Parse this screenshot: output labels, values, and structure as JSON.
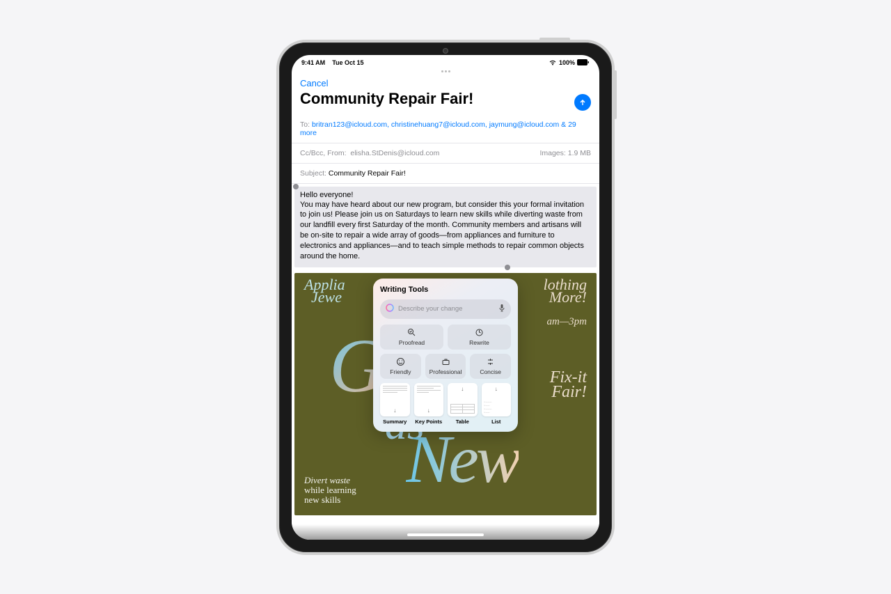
{
  "statusbar": {
    "time": "9:41 AM",
    "date": "Tue Oct 15",
    "battery": "100%"
  },
  "header": {
    "cancel": "Cancel",
    "title": "Community Repair Fair!"
  },
  "fields": {
    "to_label": "To:",
    "recipients": "britran123@icloud.com, christinehuang7@icloud.com, jaymung@icloud.com & 29 more",
    "cc_label": "Cc/Bcc, From:",
    "from": "elisha.StDenis@icloud.com",
    "images_label": "Images:",
    "images_size": "1.9 MB",
    "subject_label": "Subject:",
    "subject": "Community Repair Fair!"
  },
  "body": {
    "greeting": "Hello everyone!",
    "paragraph": "You may have heard about our new program, but consider this your formal invitation to join us! Please join us on Saturdays to learn new skills while diverting waste from our landfill every first Saturday of the month. Community members and artisans will be on-site to repair a wide array of goods—from appliances and furniture to electronics and appliances—and to teach simple methods to repair common objects around the home."
  },
  "flyer": {
    "top_left_1": "Applia",
    "top_left_2": "Jewe",
    "top_right_1": "lothing",
    "top_right_2": "More!",
    "time": "am—3pm",
    "fixit_1": "Fix-it",
    "fixit_2": "Fair!",
    "big_g": "G",
    "big_as": "as",
    "big_new": "New",
    "tag_1": "Divert waste",
    "tag_2": "while learning",
    "tag_3": "new skills"
  },
  "writing_tools": {
    "title": "Writing Tools",
    "placeholder": "Describe your change",
    "proofread": "Proofread",
    "rewrite": "Rewrite",
    "friendly": "Friendly",
    "professional": "Professional",
    "concise": "Concise",
    "summary": "Summary",
    "keypoints": "Key Points",
    "table": "Table",
    "list": "List"
  }
}
